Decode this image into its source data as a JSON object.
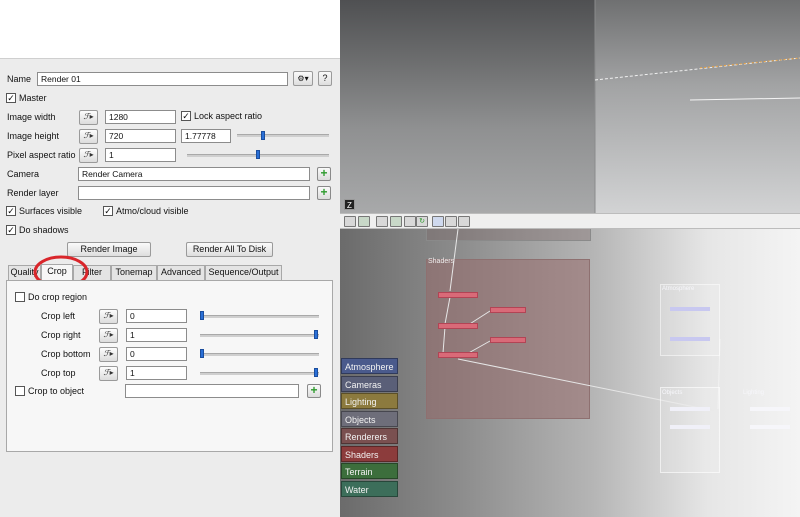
{
  "panel": {
    "name_label": "Name",
    "name_value": "Render 01",
    "gear_label": "⚙▾",
    "help_label": "?",
    "master_label": "Master",
    "image_width_label": "Image width",
    "image_width_value": "1280",
    "lock_aspect_label": "Lock aspect ratio",
    "image_height_label": "Image height",
    "image_height_value": "720",
    "aspect_value": "1.77778",
    "pixel_aspect_label": "Pixel aspect ratio",
    "pixel_aspect_value": "1",
    "camera_label": "Camera",
    "camera_value": "Render Camera",
    "render_layer_label": "Render layer",
    "render_layer_value": "",
    "surfaces_visible_label": "Surfaces visible",
    "atmo_visible_label": "Atmo/cloud visible",
    "do_shadows_label": "Do shadows",
    "render_image_label": "Render Image",
    "render_all_label": "Render All To Disk",
    "anim_glyph": "ℱ▸",
    "check_mark": "✓",
    "plus_glyph": "+"
  },
  "tabs": [
    "Quality",
    "Crop",
    "Filter",
    "Tonemap",
    "Advanced",
    "Sequence/Output"
  ],
  "crop": {
    "do_crop_label": "Do crop region",
    "crop_left_label": "Crop left",
    "crop_left_value": "0",
    "crop_right_label": "Crop right",
    "crop_right_value": "1",
    "crop_bottom_label": "Crop bottom",
    "crop_bottom_value": "0",
    "crop_top_label": "Crop top",
    "crop_top_value": "1",
    "crop_to_object_label": "Crop to object",
    "crop_to_object_value": ""
  },
  "levels": {
    "aspect_slider": 0.28,
    "pixel_aspect_slider": 0.5,
    "crop_left_slider": 0.0,
    "crop_right_slider": 1.0,
    "crop_bottom_slider": 0.0,
    "crop_top_slider": 1.0
  },
  "nodegraph": {
    "categories": [
      {
        "label": "Atmosphere",
        "color": "#4a5a8c"
      },
      {
        "label": "Cameras",
        "color": "#5a5f78"
      },
      {
        "label": "Lighting",
        "color": "#8c7a3e"
      },
      {
        "label": "Objects",
        "color": "#6e6e7a"
      },
      {
        "label": "Renderers",
        "color": "#7a5050"
      },
      {
        "label": "Shaders",
        "color": "#8c3c3c"
      },
      {
        "label": "Terrain",
        "color": "#3c6e3c"
      },
      {
        "label": "Water",
        "color": "#3c6e5a"
      }
    ],
    "shaders_group_label": "Shaders",
    "atmosphere_group_label": "Atmosphere",
    "objects_group_label": "Objects",
    "lighting_group_label": "Lighting"
  },
  "toolbar": {
    "corner_icon_label": "Z"
  },
  "colors": {
    "accent": "#2a6fd6",
    "annotation_circle": "#d9262b",
    "plus_green": "#2c9a2c"
  }
}
